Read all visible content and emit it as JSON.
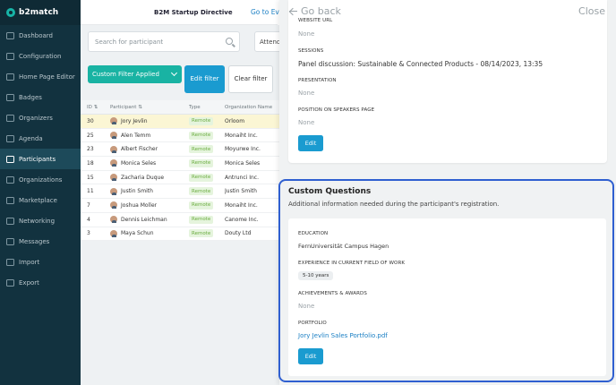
{
  "sidebar": {
    "brand": "b2match",
    "items": [
      {
        "label": "Dashboard",
        "icon": "dashboard-icon"
      },
      {
        "label": "Configuration",
        "icon": "gears-icon"
      },
      {
        "label": "Home Page Editor",
        "icon": "editor-icon"
      },
      {
        "label": "Badges",
        "icon": "badge-icon"
      },
      {
        "label": "Organizers",
        "icon": "organizers-icon"
      },
      {
        "label": "Agenda",
        "icon": "calendar-icon"
      },
      {
        "label": "Participants",
        "icon": "participants-icon",
        "active": true
      },
      {
        "label": "Organizations",
        "icon": "building-icon"
      },
      {
        "label": "Marketplace",
        "icon": "marketplace-icon"
      },
      {
        "label": "Networking",
        "icon": "networking-icon"
      },
      {
        "label": "Messages",
        "icon": "envelope-icon"
      },
      {
        "label": "Import",
        "icon": "import-icon"
      },
      {
        "label": "Export",
        "icon": "export-icon"
      }
    ]
  },
  "header": {
    "event_name": "B2M Startup Directive",
    "goto_label": "Go to Eve"
  },
  "toolbar": {
    "search_placeholder": "Search for participant",
    "attendance_label": "Attend",
    "filter_selected": "Custom Filter Applied",
    "edit_filter_label": "Edit filter",
    "clear_filter_label": "Clear filter"
  },
  "table": {
    "columns": [
      "ID",
      "Participant",
      "Type",
      "Organization Name"
    ],
    "rows": [
      {
        "id": "30",
        "name": "Jory Jevlin",
        "type": "Remote",
        "org": "Orloom",
        "highlight": true
      },
      {
        "id": "25",
        "name": "Alen Temm",
        "type": "Remote",
        "org": "Monaiht Inc."
      },
      {
        "id": "23",
        "name": "Albert Fischer",
        "type": "Remote",
        "org": "Moyurwe Inc."
      },
      {
        "id": "18",
        "name": "Monica Seles",
        "type": "Remote",
        "org": "Monica Seles"
      },
      {
        "id": "15",
        "name": "Zacharia Duque",
        "type": "Remote",
        "org": "Antrunci Inc."
      },
      {
        "id": "11",
        "name": "Justin Smith",
        "type": "Remote",
        "org": "Justin Smith"
      },
      {
        "id": "7",
        "name": "Joshua Moller",
        "type": "Remote",
        "org": "Monaiht Inc."
      },
      {
        "id": "4",
        "name": "Dennis Leichman",
        "type": "Remote",
        "org": "Canome Inc."
      },
      {
        "id": "3",
        "name": "Maya Schun",
        "type": "Remote",
        "org": "Douty Ltd"
      }
    ]
  },
  "drawer": {
    "go_back": "Go back",
    "close": "Close",
    "profile": {
      "website_label": "WEBSITE URL",
      "website_value": "None",
      "sessions_label": "SESSIONS",
      "sessions_value": "Panel discussion: Sustainable & Connected Products - 08/14/2023, 13:35",
      "presentation_label": "PRESENTATION",
      "presentation_value": "None",
      "position_label": "POSITION ON SPEAKERS PAGE",
      "position_value": "None",
      "edit_label": "Edit"
    },
    "custom_questions": {
      "title": "Custom Questions",
      "subtitle": "Additional information needed during the participant's registration.",
      "education_label": "EDUCATION",
      "education_value": "FernUniversität Campus Hagen",
      "experience_label": "EXPERIENCE IN CURRENT FIELD OF WORK",
      "experience_value": "5-10 years",
      "achievements_label": "ACHIEVEMENTS & AWARDS",
      "achievements_value": "None",
      "portfolio_label": "PORTFOLIO",
      "portfolio_value": "Jory Jevlin Sales Portfolio.pdf",
      "edit_label": "Edit"
    }
  },
  "colors": {
    "sidebar_bg": "#12323f",
    "accent_teal": "#19b3a3",
    "primary_blue": "#1a9bd0",
    "highlight_border": "#2f5fd0",
    "remote_badge": "#6aac3f"
  }
}
